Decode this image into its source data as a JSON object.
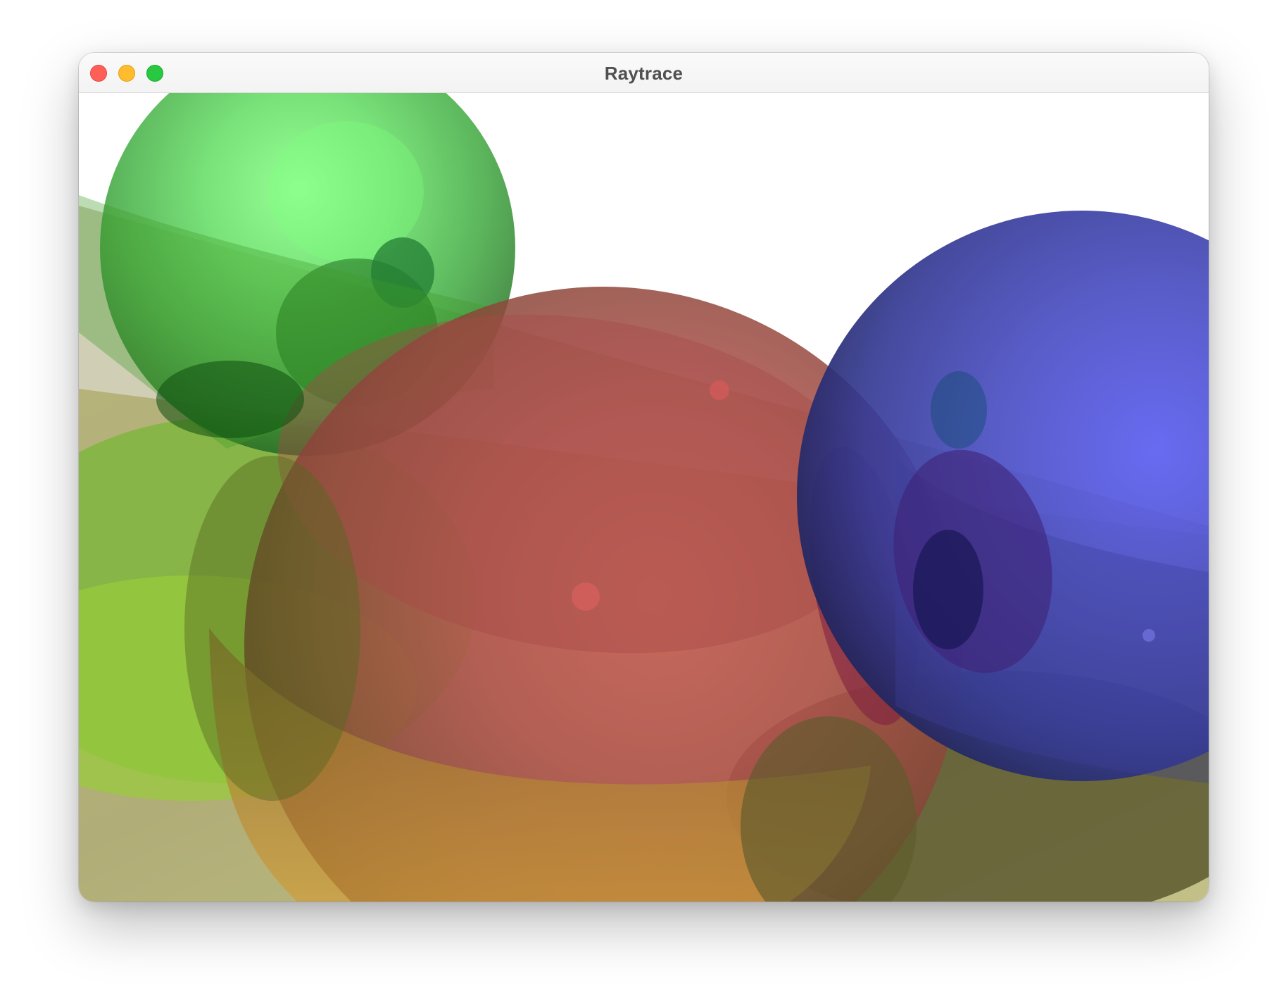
{
  "window": {
    "title": "Raytrace"
  },
  "window_controls": {
    "close": "close-button",
    "minimize": "minimize-button",
    "zoom": "zoom-button"
  },
  "scene": {
    "background_color": "#ffffff",
    "floor_color": "#d9d58f",
    "sphere_colors": {
      "green": "#50d050",
      "red": "#bf4a45",
      "blue": "#4b4fc6"
    }
  }
}
